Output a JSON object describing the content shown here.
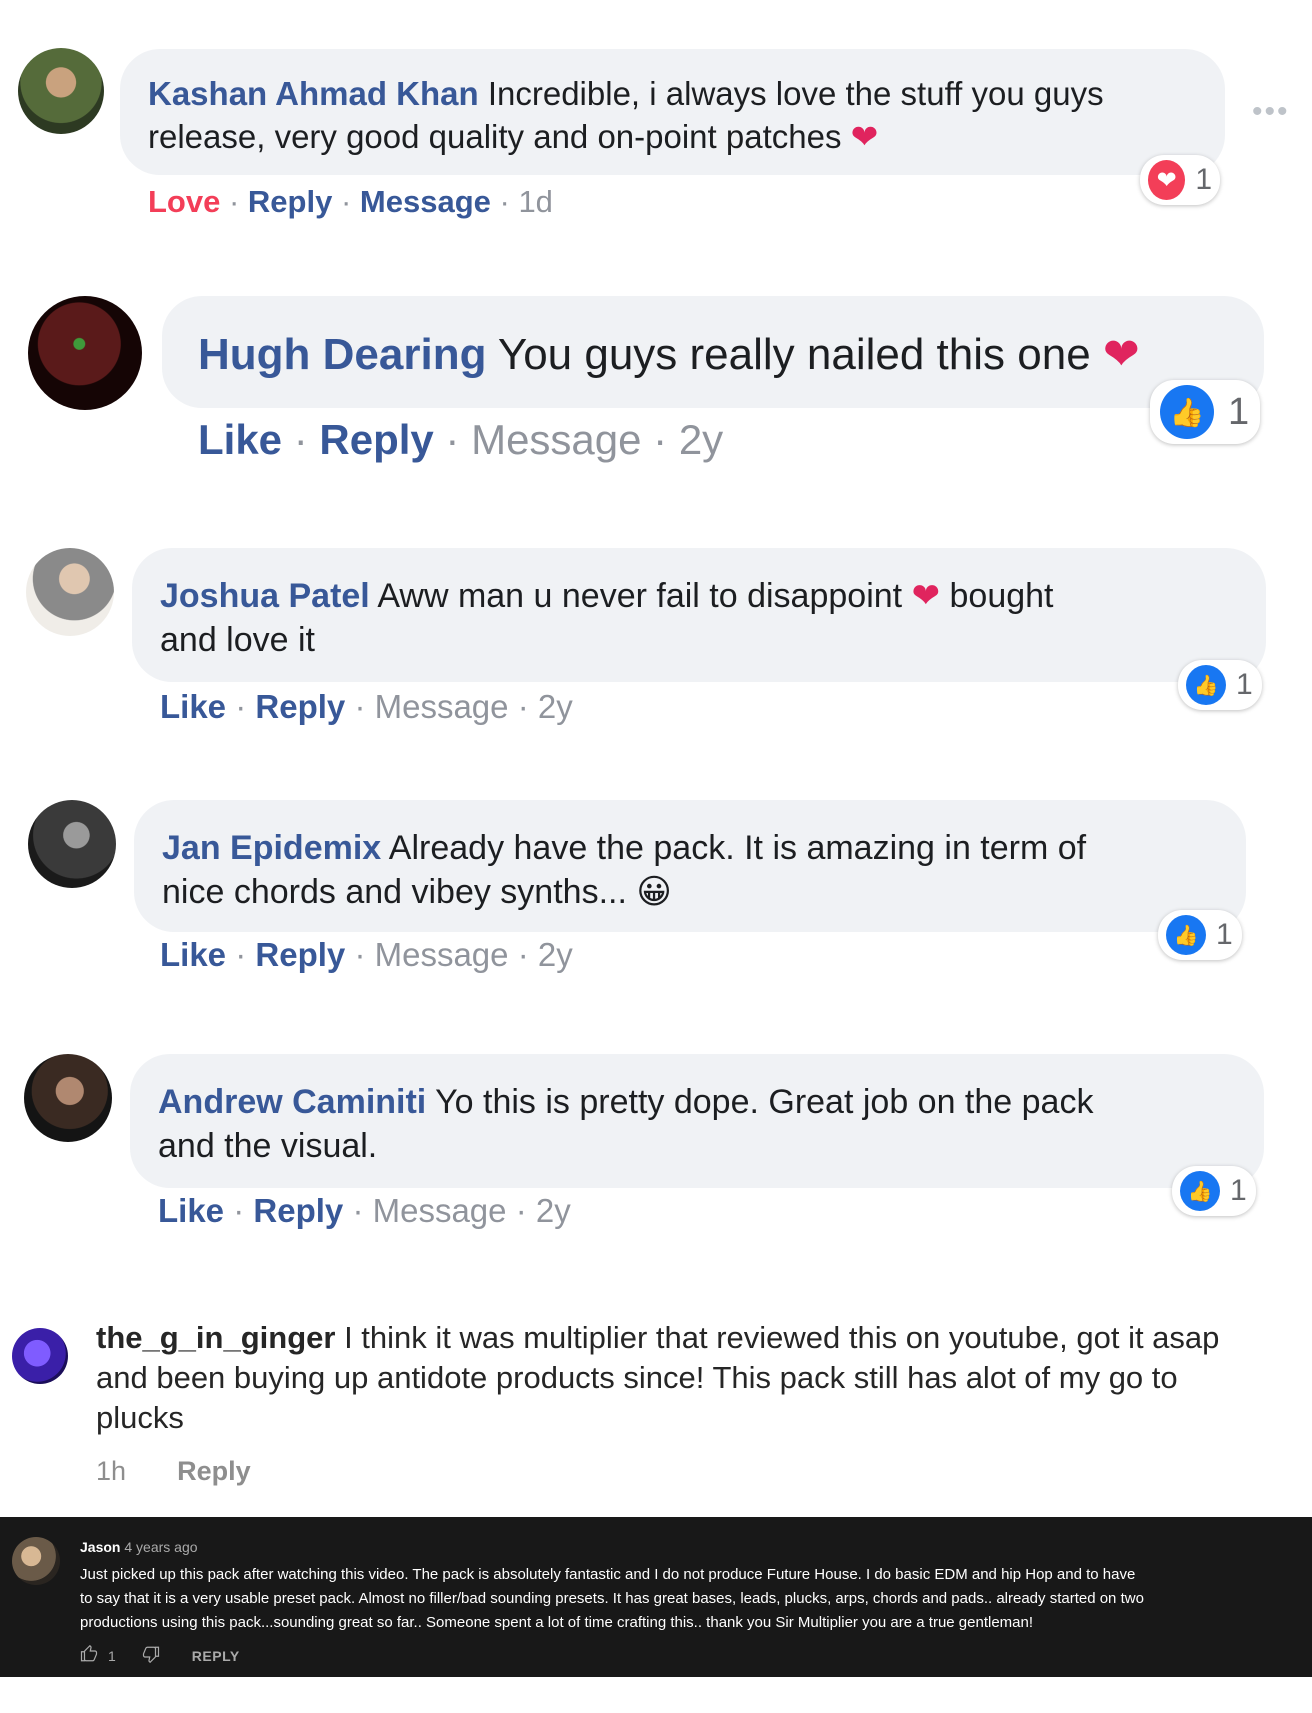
{
  "fb_comments": [
    {
      "name": "Kashan Ahmad Khan",
      "text_a": "Incredible, i always love the stuff you guys",
      "text_b": "release, very good quality and on-point patches",
      "action1": "Love",
      "reply": "Reply",
      "message": "Message",
      "time": "1d",
      "count": "1",
      "reaction_icon": "love-icon"
    },
    {
      "name": "Hugh Dearing",
      "text_a": "You guys really nailed this one",
      "action1": "Like",
      "reply": "Reply",
      "message": "Message",
      "time": "2y",
      "count": "1",
      "reaction_icon": "like-icon"
    },
    {
      "name": "Joshua Patel",
      "text_a": "Aww man u never fail to disappoint",
      "text_a2": "bought",
      "text_b": "and love it",
      "action1": "Like",
      "reply": "Reply",
      "message": "Message",
      "time": "2y",
      "count": "1",
      "reaction_icon": "like-icon"
    },
    {
      "name": "Jan Epidemix",
      "text_a": "Already have the pack. It is amazing in term of",
      "text_b": "nice chords and vibey synths...",
      "action1": "Like",
      "reply": "Reply",
      "message": "Message",
      "time": "2y",
      "count": "1",
      "reaction_icon": "like-icon"
    },
    {
      "name": "Andrew Caminiti",
      "text_a": "Yo this is pretty dope. Great job on the pack",
      "text_b": "and the visual.",
      "action1": "Like",
      "reply": "Reply",
      "message": "Message",
      "time": "2y",
      "count": "1",
      "reaction_icon": "like-icon"
    }
  ],
  "ig_comment": {
    "name": "the_g_in_ginger",
    "text_a": "I think it was multiplier that reviewed this on youtube, got it asap",
    "text_b": "and been buying up antidote products since! This pack still has alot of my go to",
    "text_c": "plucks",
    "time": "1h",
    "reply": "Reply"
  },
  "yt_comment": {
    "name": "Jason",
    "time": "4 years ago",
    "line1": "Just picked up this pack after watching this video. The pack is absolutely fantastic and I do not produce Future House. I do basic EDM and hip Hop and to have",
    "line2": "to say that it is a very usable preset pack. Almost no filler/bad sounding presets. It has great bases, leads, plucks, arps, chords and pads.. already started on two",
    "line3": "productions using this pack...sounding great so far.. Someone spent a lot of time crafting this.. thank you Sir Multiplier you are a true gentleman!",
    "likes": "1",
    "reply": "REPLY"
  },
  "colors": {
    "fb_blue": "#385898",
    "like_blue": "#1877f2",
    "love_red": "#f33e58",
    "bubble": "#f0f2f5",
    "yt_bg": "#181818"
  }
}
